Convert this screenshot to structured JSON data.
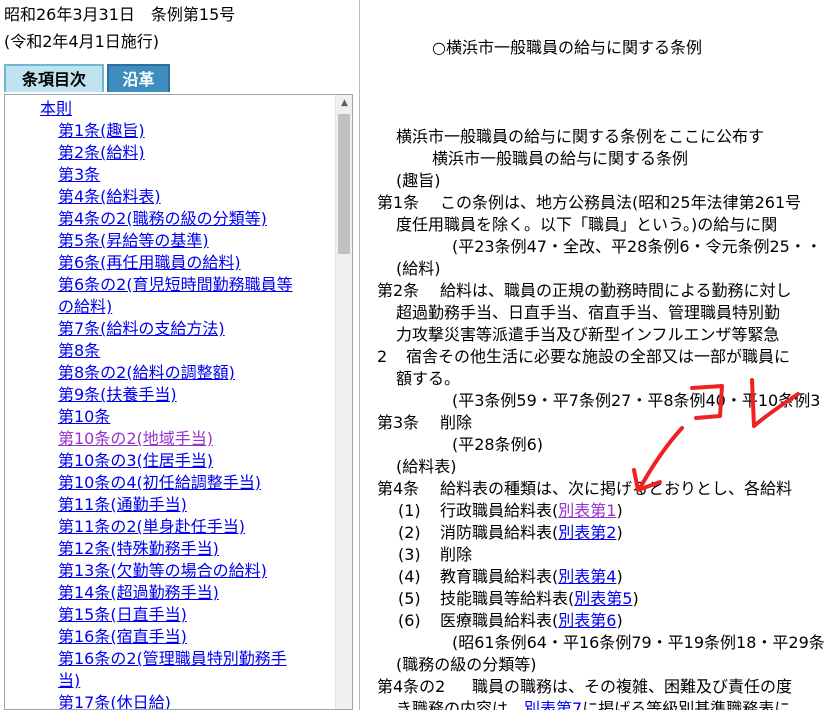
{
  "meta": {
    "enacted": "昭和26年3月31日　条例第15号",
    "effective": "(令和2年4月1日施行)"
  },
  "tabs": {
    "toc": "条項目次",
    "history": "沿革"
  },
  "toc": {
    "root": "本則",
    "items": [
      "第1条(趣旨)",
      "第2条(給料)",
      "第3条",
      "第4条(給料表)",
      "第4条の2(職務の級の分類等)",
      "第5条(昇給等の基準)",
      "第6条(再任用職員の給料)",
      "第6条の2(育児短時間勤務職員等",
      "の給料)",
      "第7条(給料の支給方法)",
      "第8条",
      "第8条の2(給料の調整額)",
      "第9条(扶養手当)",
      "第10条",
      "第10条の2(地域手当)",
      "第10条の3(住居手当)",
      "第10条の4(初任給調整手当)",
      "第11条(通勤手当)",
      "第11条の2(単身赴任手当)",
      "第12条(特殊勤務手当)",
      "第13条(欠勤等の場合の給料)",
      "第14条(超過勤務手当)",
      "第15条(日直手当)",
      "第16条(宿直手当)",
      "第16条の2(管理職員特別勤務手",
      "当)",
      "第17条(休日給)"
    ]
  },
  "doc": {
    "title": "○横浜市一般職員の給与に関する条例",
    "promulgation": "横浜市一般職員の給与に関する条例をここに公布す",
    "law_name": "横浜市一般職員の給与に関する条例",
    "h_purpose": "(趣旨)",
    "a1_label": "第1条",
    "a1_l1": "この条例は、地方公務員法(昭和25年法律第261号",
    "a1_l2": "度任用職員を除く。以下「職員」という。)の給与に関",
    "a1_hist": "(平23条例47・全改、平28条例6・令元条例25・・",
    "h_salary": "(給料)",
    "a2_label": "第2条",
    "a2_l1": "給料は、職員の正規の勤務時間による勤務に対し",
    "a2_l2": "超過勤務手当、日直手当、宿直手当、管理職員特別勤",
    "a2_l3": "力攻撃災害等派遣手当及び新型インフルエンザ等緊急",
    "a2_p2_num": "2",
    "a2_p2_l1": "宿舎その他生活に必要な施設の全部又は一部が職員に",
    "a2_p2_l2": "額する。",
    "a2_hist": "(平3条例59・平7条例27・平8条例40・平10条例3",
    "a3_label": "第3条",
    "a3_text": "削除",
    "a3_hist": "(平28条例6)",
    "h_table": "(給料表)",
    "a4_label": "第4条",
    "a4_l1": "給料表の種類は、次に掲げるとおりとし、各給料",
    "a4_items": [
      {
        "num": "(1)",
        "text": "行政職員給料表(",
        "link": "別表第1",
        "close": ")"
      },
      {
        "num": "(2)",
        "text": "消防職員給料表(",
        "link": "別表第2",
        "close": ")"
      },
      {
        "num": "(3)",
        "text": "削除",
        "link": "",
        "close": ""
      },
      {
        "num": "(4)",
        "text": "教育職員給料表(",
        "link": "別表第4",
        "close": ")"
      },
      {
        "num": "(5)",
        "text": "技能職員等給料表(",
        "link": "別表第5",
        "close": ")"
      },
      {
        "num": "(6)",
        "text": "医療職員給料表(",
        "link": "別表第6",
        "close": ")"
      }
    ],
    "a4_hist": "(昭61条例64・平16条例79・平19条例18・平29条",
    "h_grade": "(職務の級の分類等)",
    "a4_2_label": "第4条の2",
    "a4_2_l1": "職員の職務は、その複雑、困難及び責任の度",
    "a4_2_l2_pre": "き職務の内容は、",
    "a4_2_l2_link": "別表第7",
    "a4_2_l2_post": "に掲げる等級別基準職務表に"
  },
  "annotation": {
    "text": "コレ",
    "color": "#ee2222"
  },
  "colors": {
    "link": "#0000ee",
    "visited": "#9932cc",
    "tab_active": "#3f8cbf"
  }
}
